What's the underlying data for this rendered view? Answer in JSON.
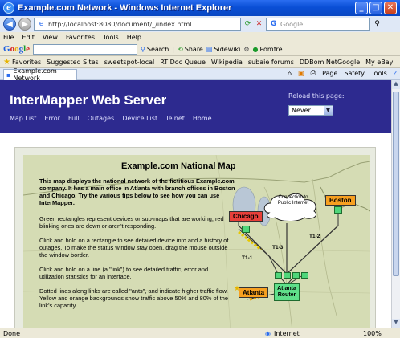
{
  "window": {
    "title": "Example.com Network - Windows Internet Explorer"
  },
  "address": {
    "url": "http://localhost:8080/document/_/index.html",
    "search_placeholder": "Google"
  },
  "menu": [
    "File",
    "Edit",
    "View",
    "Favorites",
    "Tools",
    "Help"
  ],
  "google_toolbar": {
    "logo": "Google",
    "items": [
      "Search",
      "Share",
      "Sidewiki",
      "Pomfre..."
    ]
  },
  "favorites": {
    "label": "Favorites",
    "items": [
      "Suggested Sites",
      "sweetspot-local",
      "RT Doc Queue",
      "Wikipedia",
      "subaie forums",
      "DDBom NetGoogle",
      "My eBay"
    ]
  },
  "tab": {
    "label": "Example.com Network"
  },
  "tab_tools": [
    "Page",
    "Safety",
    "Tools"
  ],
  "header": {
    "title": "InterMapper Web Server",
    "nav": [
      "Map List",
      "Error",
      "Full",
      "Outages",
      "Device List",
      "Telnet",
      "Home"
    ],
    "reload_label": "Reload this page:",
    "reload_value": "Never"
  },
  "map": {
    "title": "Example.com National Map",
    "intro": "This map displays the national network of the fictitious Example.com company. It has a main office in Atlanta with branch offices in Boston and Chicago. Try the various tips below to see how you can use InterMapper.",
    "tips": [
      "Green rectangles represent devices or sub-maps that are working; red blinking ones are down or aren't responding.",
      "Click and hold on a rectangle to see detailed device info and a history of outages. To make the status window stay open, drag the mouse outside the window border.",
      "Click and hold on a line (a \"link\") to see detailed traffic, error and utilization statistics for an interface.",
      "Dotted lines along links are called \"ants\", and indicate higher traffic flow. Yellow and orange backgrounds show traffic above 50% and 80% of the link's capacity."
    ],
    "labels": {
      "chicago": "Chicago",
      "boston": "Boston",
      "atlanta": "Atlanta",
      "router": "Atlanta Router",
      "cloud": "Connection to Public Internet",
      "t1_1": "T1-1",
      "t1_2": "T1-2",
      "t1_3": "T1-3"
    }
  },
  "status": {
    "left": "Done",
    "zone": "Internet",
    "zoom": "100%"
  }
}
